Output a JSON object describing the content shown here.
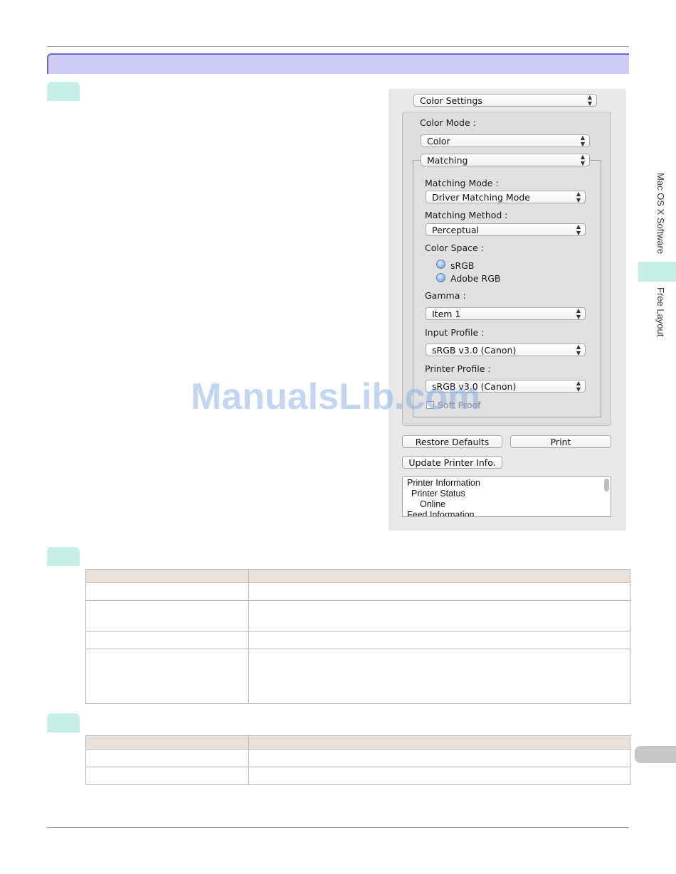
{
  "sidebar": {
    "section_label": "Mac OS X Software",
    "page_label": "Free Layout"
  },
  "dialog": {
    "panel_select": "Color Settings",
    "color_mode_label": "Color Mode :",
    "color_mode_value": "Color",
    "sub_panel_select": "Matching",
    "matching_mode_label": "Matching Mode :",
    "matching_mode_value": "Driver Matching Mode",
    "matching_method_label": "Matching Method :",
    "matching_method_value": "Perceptual",
    "color_space_label": "Color Space :",
    "color_space_options": [
      "sRGB",
      "Adobe RGB"
    ],
    "gamma_label": "Gamma :",
    "gamma_value": "Item 1",
    "input_profile_label": "Input Profile :",
    "input_profile_value": "sRGB v3.0 (Canon)",
    "printer_profile_label": "Printer Profile :",
    "printer_profile_value": "sRGB v3.0 (Canon)",
    "soft_proof_label": "Soft Proof",
    "restore_defaults_label": "Restore Defaults",
    "print_label": "Print",
    "update_info_label": "Update Printer Info.",
    "info_lines": [
      "Printer Information",
      "Printer Status",
      "Online",
      "Feed Information"
    ]
  },
  "watermark": "ManualsLib.com",
  "colors": {
    "title_bar": "#ccccf7",
    "title_border": "#6a6ad6",
    "step_tab": "#c5efe4",
    "table_header": "#e8e1dc"
  }
}
